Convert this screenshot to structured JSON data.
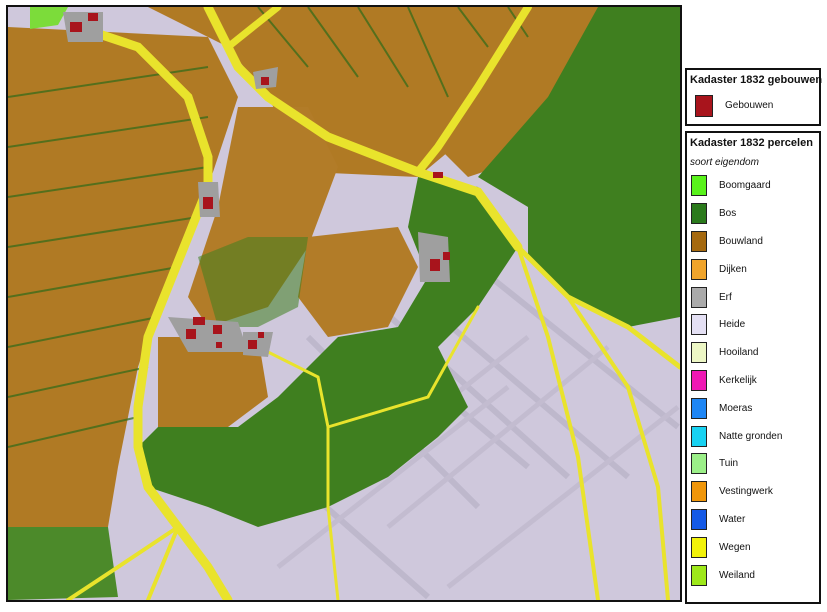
{
  "legend_buildings": {
    "title": "Kadaster 1832 gebouwen",
    "items": [
      {
        "label": "Gebouwen",
        "color": "#a8141c"
      }
    ]
  },
  "legend_parcels": {
    "title": "Kadaster 1832 percelen",
    "subtitle": "soort eigendom",
    "items": [
      {
        "label": "Boomgaard",
        "color": "#59f21b"
      },
      {
        "label": "Bos",
        "color": "#2b7a1c"
      },
      {
        "label": "Bouwland",
        "color": "#a5690f"
      },
      {
        "label": "Dijken",
        "color": "#f0a42b"
      },
      {
        "label": "Erf",
        "color": "#aaaaaa"
      },
      {
        "label": "Heide",
        "color": "#e4e0f4"
      },
      {
        "label": "Hooiland",
        "color": "#edf7c5"
      },
      {
        "label": "Kerkelijk",
        "color": "#ef18b4"
      },
      {
        "label": "Moeras",
        "color": "#1e86f5"
      },
      {
        "label": "Natte gronden",
        "color": "#18d2f2"
      },
      {
        "label": "Tuin",
        "color": "#9bef88"
      },
      {
        "label": "Vestingwerk",
        "color": "#f0960a"
      },
      {
        "label": "Water",
        "color": "#1459e6"
      },
      {
        "label": "Wegen",
        "color": "#f2f20a"
      },
      {
        "label": "Weiland",
        "color": "#9ee81a"
      }
    ]
  },
  "map_colors": {
    "heide": "#cfc8dc",
    "bouwland": "#b07a24",
    "bos": "#3f7f1f",
    "wegen": "#e9e32c",
    "erf": "#9f9f9f",
    "gebouwen": "#a8141c",
    "boomgaard": "#7cdc3a"
  }
}
